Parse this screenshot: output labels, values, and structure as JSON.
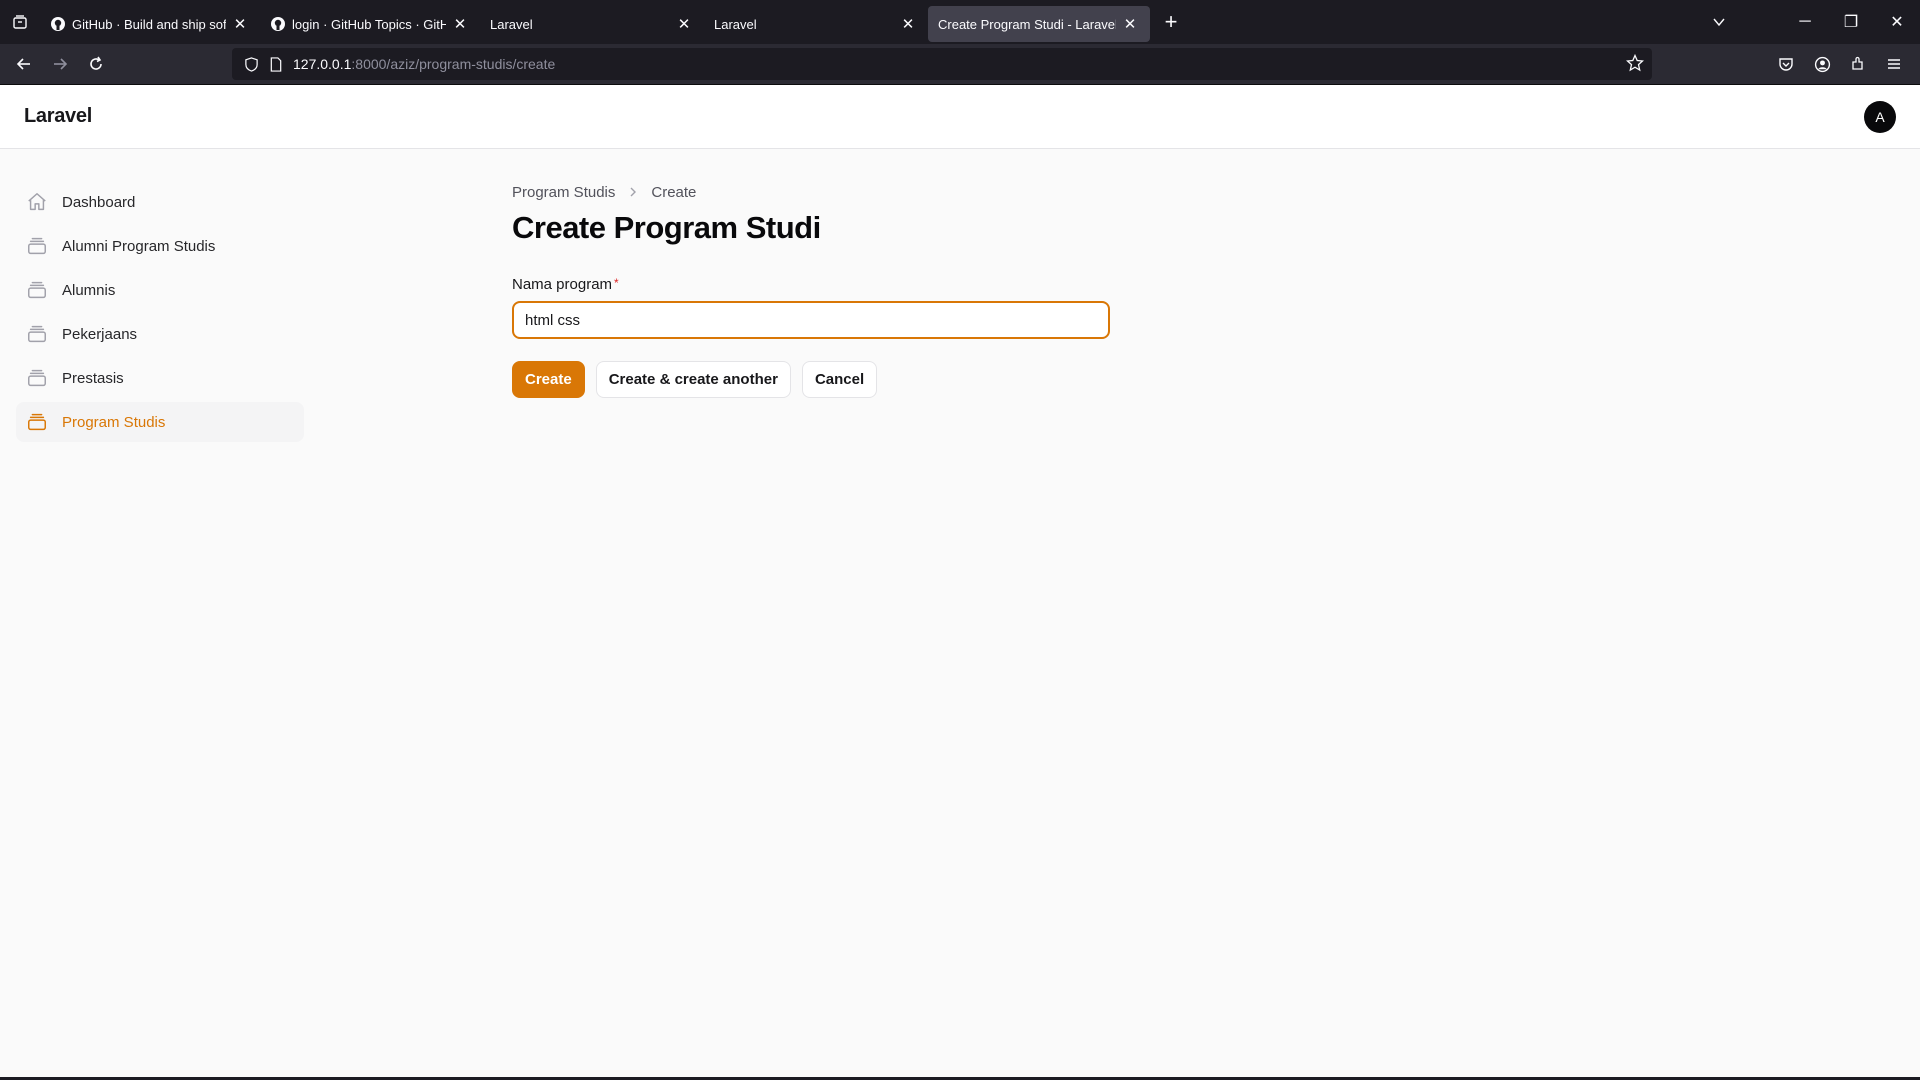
{
  "browser": {
    "tabs": [
      {
        "title": "GitHub · Build and ship software",
        "icon": "github-icon",
        "active": false
      },
      {
        "title": "login · GitHub Topics · GitHub",
        "icon": "github-icon",
        "active": false
      },
      {
        "title": "Laravel",
        "icon": "",
        "active": false
      },
      {
        "title": "Laravel",
        "icon": "",
        "active": false
      },
      {
        "title": "Create Program Studi - Laravel",
        "icon": "",
        "active": true
      }
    ],
    "url_host": "127.0.0.1",
    "url_path": ":8000/aziz/program-studis/create"
  },
  "app": {
    "brand": "Laravel",
    "avatar_initial": "A",
    "accent_color": "#d97706"
  },
  "sidebar": {
    "items": [
      {
        "label": "Dashboard",
        "icon": "home-icon",
        "active": false
      },
      {
        "label": "Alumni Program Studis",
        "icon": "collection-icon",
        "active": false
      },
      {
        "label": "Alumnis",
        "icon": "collection-icon",
        "active": false
      },
      {
        "label": "Pekerjaans",
        "icon": "collection-icon",
        "active": false
      },
      {
        "label": "Prestasis",
        "icon": "collection-icon",
        "active": false
      },
      {
        "label": "Program Studis",
        "icon": "collection-icon",
        "active": true
      }
    ]
  },
  "main": {
    "breadcrumb": [
      "Program Studis",
      "Create"
    ],
    "title": "Create Program Studi",
    "field_label": "Nama program",
    "required_mark": "*",
    "field_value": "html css",
    "buttons": {
      "create": "Create",
      "create_another": "Create & create another",
      "cancel": "Cancel"
    }
  }
}
